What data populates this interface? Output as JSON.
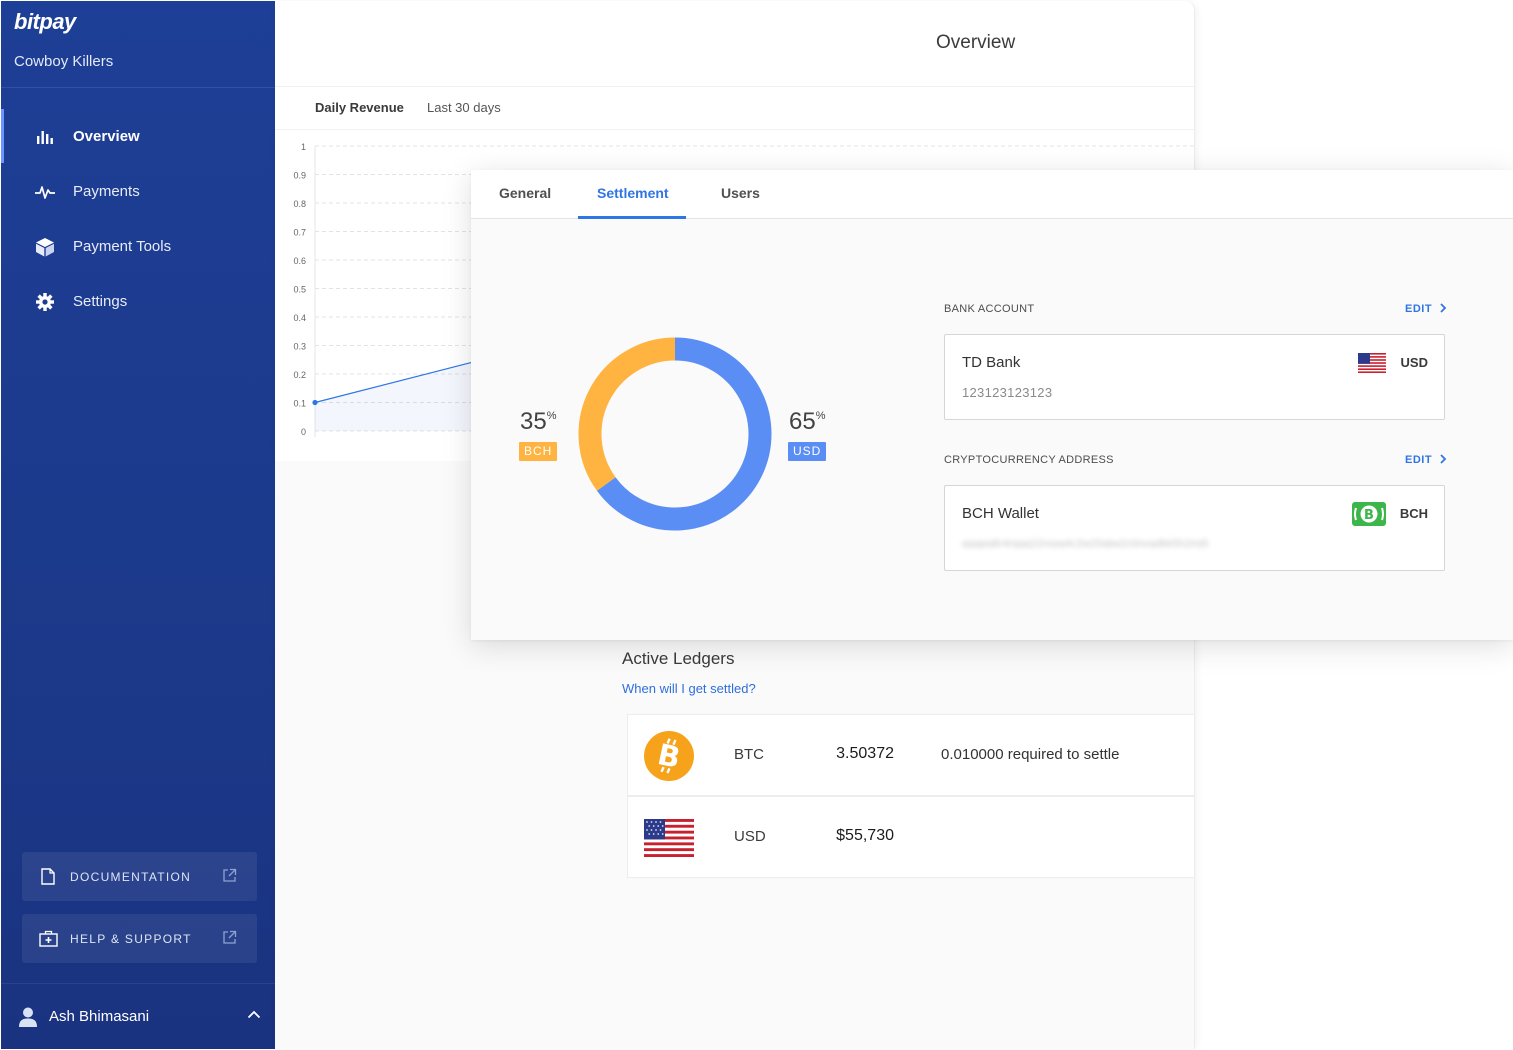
{
  "sidebar": {
    "logo": "bitpay",
    "org_name": "Cowboy Killers",
    "nav": [
      {
        "label": "Overview",
        "icon": "bar-chart-icon",
        "active": true
      },
      {
        "label": "Payments",
        "icon": "pulse-icon",
        "active": false
      },
      {
        "label": "Payment Tools",
        "icon": "cube-icon",
        "active": false
      },
      {
        "label": "Settings",
        "icon": "gear-icon",
        "active": false
      }
    ],
    "documentation_label": "DOCUMENTATION",
    "help_label": "HELP & SUPPORT",
    "user_name": "Ash Bhimasani"
  },
  "header": {
    "title": "Overview"
  },
  "revenue": {
    "title": "Daily Revenue",
    "period": "Last 30 days",
    "chart_data": {
      "type": "area",
      "title": "Daily Revenue",
      "ylim": [
        0,
        1
      ],
      "y_ticks": [
        "1",
        "0.9",
        "0.8",
        "0.7",
        "0.6",
        "0.5",
        "0.4",
        "0.3",
        "0.2",
        "0.1",
        "0"
      ],
      "series": [
        {
          "values": [
            0.1,
            0.24
          ]
        }
      ],
      "grid": true,
      "color": "#2f75e5"
    }
  },
  "settlement": {
    "tabs": [
      {
        "label": "General",
        "active": false
      },
      {
        "label": "Settlement",
        "active": true
      },
      {
        "label": "Users",
        "active": false
      }
    ],
    "chart_data": {
      "type": "pie",
      "categories": [
        "BCH",
        "USD"
      ],
      "values": [
        35,
        65
      ],
      "colors": [
        "#ffb340",
        "#5b8ef5"
      ]
    },
    "bch_pct": "35",
    "usd_pct": "65",
    "pct_suffix": "%",
    "bch_label": "BCH",
    "usd_label": "USD",
    "bank_label": "BANK ACCOUNT",
    "edit_label": "EDIT",
    "bank_name": "TD Bank",
    "bank_number": "123123123123",
    "bank_currency": "USD",
    "crypto_label": "CRYPTOCURRENCY ADDRESS",
    "wallet_name": "BCH Wallet",
    "wallet_address": "qqqpq8r4rgqq22nrpq4c2w20qtw2c0nvqdkk5h2mj5",
    "wallet_currency": "BCH"
  },
  "ledgers": {
    "title": "Active Ledgers",
    "help_link": "When will I get settled?",
    "rows": [
      {
        "code": "BTC",
        "amount": "3.50372",
        "note": "0.010000 required to settle",
        "icon": "bitcoin-icon"
      },
      {
        "code": "USD",
        "amount": "$55,730",
        "note": "",
        "icon": "us-flag-icon"
      }
    ]
  }
}
